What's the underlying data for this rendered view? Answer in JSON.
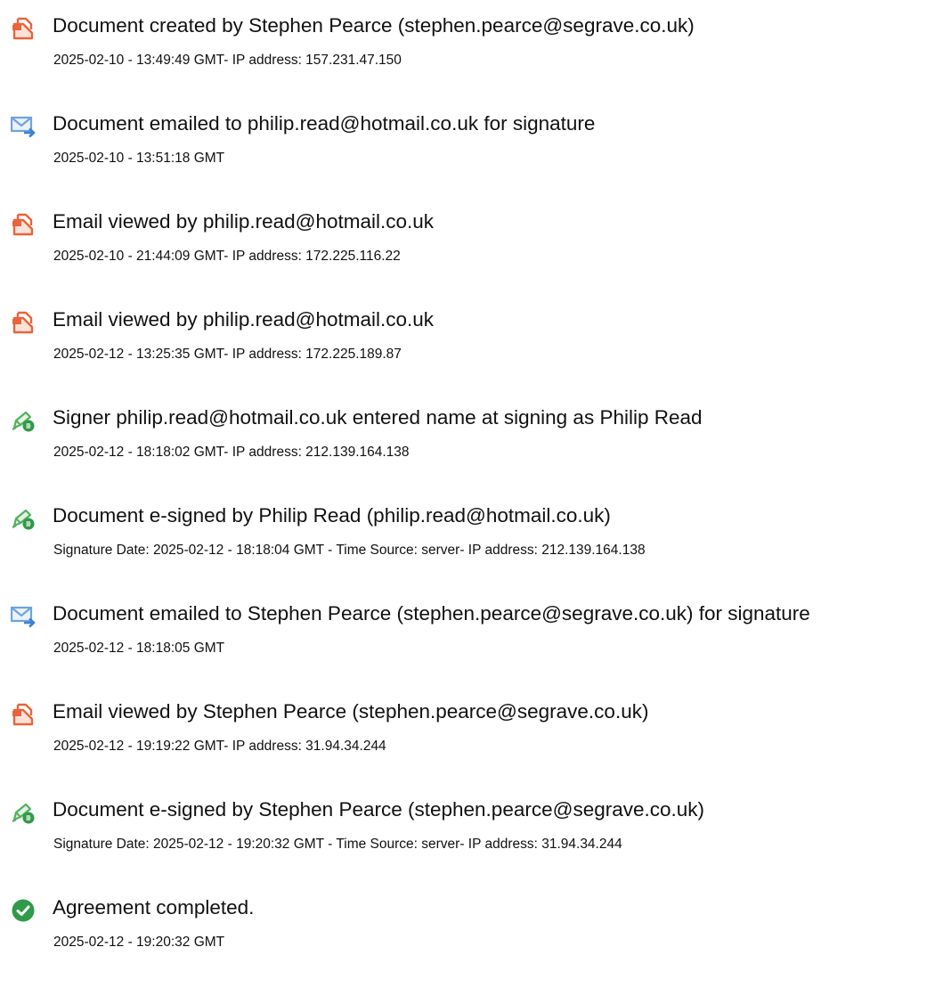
{
  "audit_trail": {
    "events": [
      {
        "icon": "document-icon",
        "title": "Document created by Stephen Pearce (stephen.pearce@segrave.co.uk)",
        "detail": "2025-02-10 - 13:49:49 GMT- IP address: 157.231.47.150"
      },
      {
        "icon": "email-sent-icon",
        "title": "Document emailed to philip.read@hotmail.co.uk for signature",
        "detail": "2025-02-10 - 13:51:18 GMT"
      },
      {
        "icon": "document-icon",
        "title": "Email viewed by philip.read@hotmail.co.uk",
        "detail": "2025-02-10 - 21:44:09 GMT- IP address: 172.225.116.22"
      },
      {
        "icon": "document-icon",
        "title": "Email viewed by philip.read@hotmail.co.uk",
        "detail": "2025-02-12 - 13:25:35 GMT- IP address: 172.225.189.87"
      },
      {
        "icon": "pen-sign-icon",
        "title": "Signer philip.read@hotmail.co.uk entered name at signing as Philip Read",
        "detail": "2025-02-12 - 18:18:02 GMT- IP address: 212.139.164.138"
      },
      {
        "icon": "pen-sign-icon",
        "title": "Document e-signed by Philip Read (philip.read@hotmail.co.uk)",
        "detail": "Signature Date: 2025-02-12 - 18:18:04 GMT - Time Source: server- IP address: 212.139.164.138"
      },
      {
        "icon": "email-sent-icon",
        "title": "Document emailed to Stephen Pearce (stephen.pearce@segrave.co.uk) for signature",
        "detail": "2025-02-12 - 18:18:05 GMT"
      },
      {
        "icon": "document-icon",
        "title": "Email viewed by Stephen Pearce (stephen.pearce@segrave.co.uk)",
        "detail": "2025-02-12 - 19:19:22 GMT- IP address: 31.94.34.244"
      },
      {
        "icon": "pen-sign-icon",
        "title": "Document e-signed by Stephen Pearce (stephen.pearce@segrave.co.uk)",
        "detail": "Signature Date: 2025-02-12 - 19:20:32 GMT - Time Source: server- IP address: 31.94.34.244"
      },
      {
        "icon": "check-circle-icon",
        "title": "Agreement completed.",
        "detail": "2025-02-12 - 19:20:32 GMT"
      }
    ]
  },
  "colors": {
    "document_icon": "#e8643c",
    "email_icon": "#6ea4dc",
    "pen_icon": "#54b05e",
    "check_icon": "#2f9a49",
    "text": "#111111"
  }
}
